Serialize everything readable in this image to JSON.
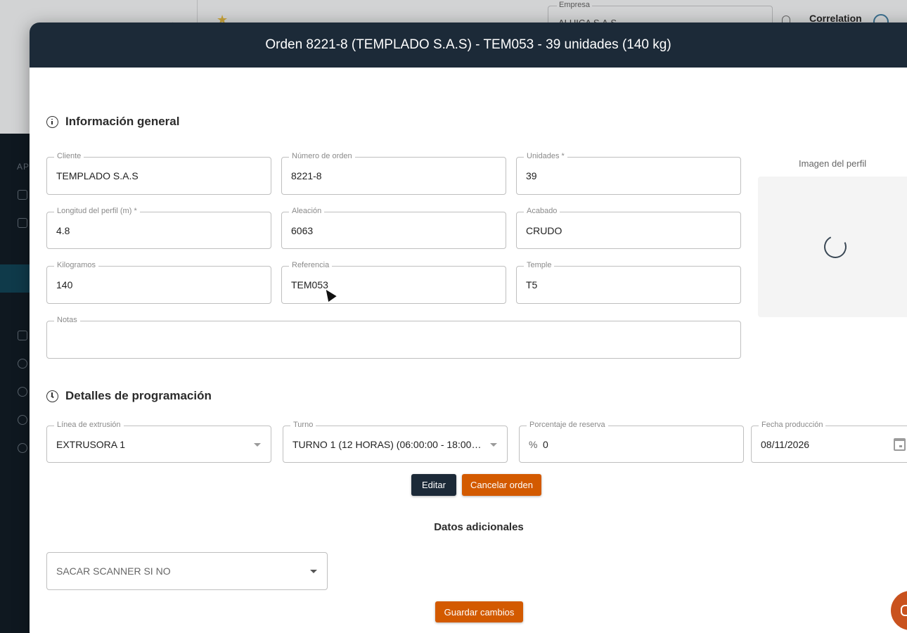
{
  "background": {
    "sidebar_label": "AP",
    "empresa_label": "Empresa",
    "empresa_value": "ALUICA S.A.S",
    "user_name": "Correlation"
  },
  "modal": {
    "title": "Orden 8221-8 (TEMPLADO S.A.S) - TEM053 - 39 unidades (140 kg)",
    "general": {
      "title": "Información general",
      "cliente": {
        "label": "Cliente",
        "value": "TEMPLADO S.A.S"
      },
      "numero_orden": {
        "label": "Número de orden",
        "value": "8221-8"
      },
      "unidades": {
        "label": "Unidades *",
        "value": "39"
      },
      "longitud": {
        "label": "Longitud del perfil (m) *",
        "value": "4.8"
      },
      "aleacion": {
        "label": "Aleación",
        "value": "6063"
      },
      "acabado": {
        "label": "Acabado",
        "value": "CRUDO"
      },
      "kilogramos": {
        "label": "Kilogramos",
        "value": "140"
      },
      "referencia": {
        "label": "Referencia",
        "value": "TEM053"
      },
      "temple": {
        "label": "Temple",
        "value": "T5"
      },
      "notas": {
        "label": "Notas",
        "value": ""
      },
      "imagen_label": "Imagen del perfil"
    },
    "programacion": {
      "title": "Detalles de programación",
      "linea": {
        "label": "Línea de extrusión",
        "value": "EXTRUSORA 1"
      },
      "turno": {
        "label": "Turno",
        "value": "TURNO 1 (12 HORAS) (06:00:00 - 18:00:00)"
      },
      "reserva": {
        "label": "Porcentaje de reserva",
        "prefix": "%",
        "value": "0"
      },
      "fecha": {
        "label": "Fecha producción",
        "value": "08/11/2026"
      }
    },
    "buttons": {
      "editar": "Editar",
      "cancelar": "Cancelar orden",
      "guardar": "Guardar cambios"
    },
    "adicionales": {
      "title": "Datos adicionales",
      "scanner_placeholder": "SACAR SCANNER SI NO"
    }
  },
  "colors": {
    "header": "#1c2a38",
    "accent_orange": "#d35a00",
    "sidebar": "#0f1820"
  }
}
